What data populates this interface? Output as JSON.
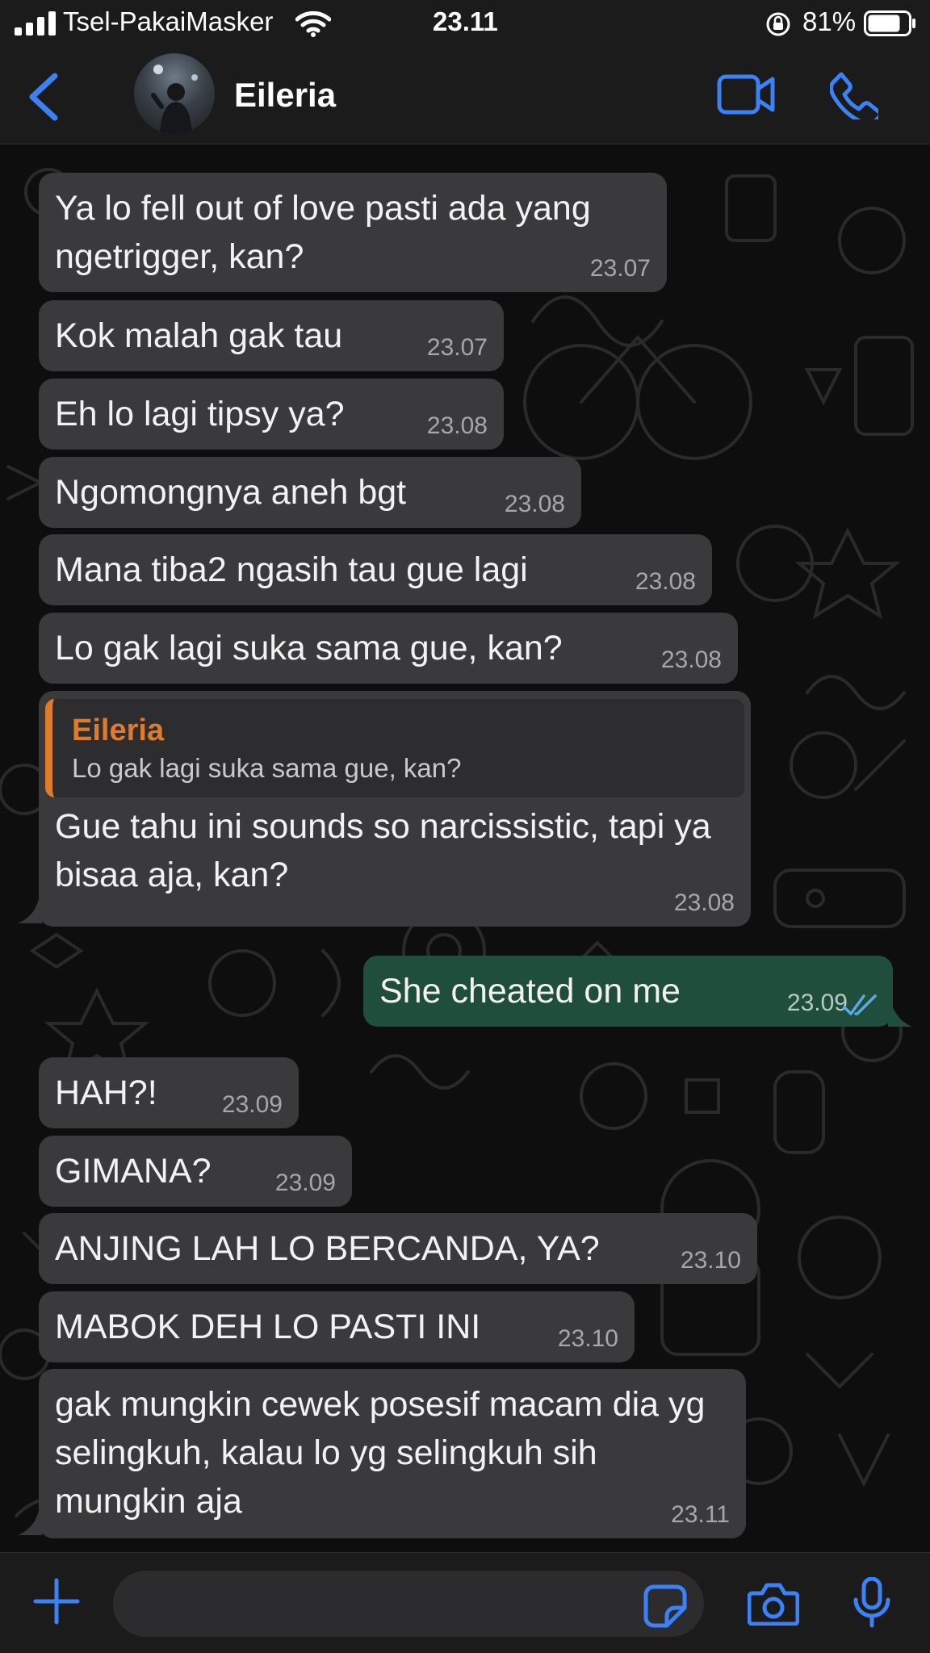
{
  "status_bar": {
    "carrier": "Tsel-PakaiMasker",
    "time": "23.11",
    "battery": "81%"
  },
  "header": {
    "contact_name": "Eileria",
    "icons": [
      "chevron-left-icon",
      "video-camera-icon",
      "phone-icon"
    ]
  },
  "messages": [
    {
      "direction": "in",
      "text": "Ya lo fell out of love pasti ada yang ngetrigger, kan?",
      "time": "23.07"
    },
    {
      "direction": "in",
      "text": "Kok malah gak tau",
      "time": "23.07"
    },
    {
      "direction": "in",
      "text": "Eh lo lagi tipsy ya?",
      "time": "23.08"
    },
    {
      "direction": "in",
      "text": "Ngomongnya aneh bgt",
      "time": "23.08"
    },
    {
      "direction": "in",
      "text": "Mana tiba2 ngasih tau gue lagi",
      "time": "23.08"
    },
    {
      "direction": "in",
      "text": "Lo gak lagi suka sama gue, kan?",
      "time": "23.08"
    },
    {
      "direction": "in",
      "quote": {
        "name": "Eileria",
        "text": "Lo gak lagi suka sama gue, kan?"
      },
      "text": "Gue tahu ini sounds so narcissistic, tapi ya bisaa aja, kan?",
      "time": "23.08"
    },
    {
      "direction": "out",
      "text": "She cheated on me",
      "time": "23.09",
      "read": true
    },
    {
      "direction": "in",
      "text": "HAH?!",
      "time": "23.09"
    },
    {
      "direction": "in",
      "text": "GIMANA?",
      "time": "23.09"
    },
    {
      "direction": "in",
      "text": "ANJING LAH LO BERCANDA, YA?",
      "time": "23.10"
    },
    {
      "direction": "in",
      "text": "MABOK DEH LO PASTI INI",
      "time": "23.10"
    },
    {
      "direction": "in",
      "text": "gak mungkin cewek posesif macam dia yg selingkuh, kalau lo yg selingkuh sih mungkin aja",
      "time": "23.11"
    }
  ],
  "input_bar": {
    "message_value": "",
    "icons": [
      "plus-icon",
      "sticker-icon",
      "camera-icon",
      "microphone-icon"
    ]
  },
  "colors": {
    "accent": "#3b82f6",
    "incoming_bubble": "#3a3a3c",
    "outgoing_bubble": "#1f4e3d",
    "quote_accent": "#e07b2c",
    "read_ticks": "#5aa9e6"
  }
}
